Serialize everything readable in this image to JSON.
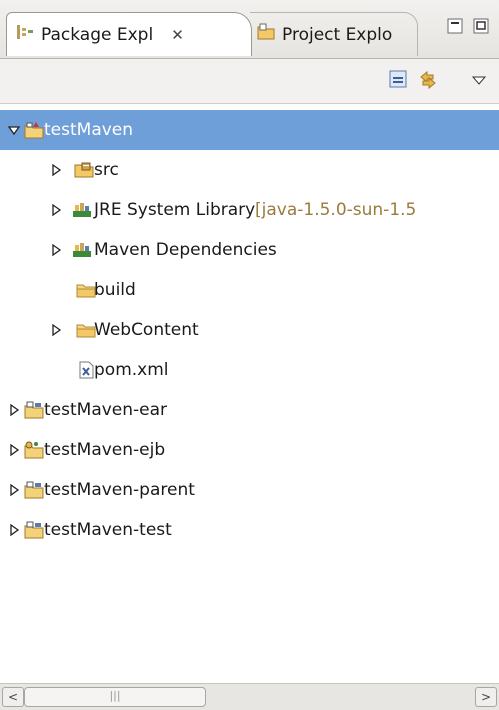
{
  "tabs": [
    {
      "label": "Package Expl",
      "close": "✕",
      "icon": "package-explorer-icon"
    },
    {
      "label": "Project Explo",
      "icon": "project-explorer-icon"
    }
  ],
  "tab_controls": {
    "minimize": "−",
    "maximize": "□"
  },
  "toolbar": {
    "collapse_icon": "collapse-all-icon",
    "link_icon": "link-with-editor-icon",
    "menu_icon": "view-menu-icon"
  },
  "tree": [
    {
      "label": "testMaven",
      "extra": "",
      "icon": "maven-project-icon",
      "twisty": "expanded",
      "selected": true
    },
    {
      "label": "src",
      "extra": "",
      "icon": "source-folder-icon",
      "twisty": "collapsed"
    },
    {
      "label": "JRE System Library ",
      "extra": "[java-1.5.0-sun-1.5",
      "icon": "library-icon",
      "twisty": "collapsed"
    },
    {
      "label": "Maven Dependencies",
      "extra": "",
      "icon": "library-icon",
      "twisty": "collapsed"
    },
    {
      "label": "build",
      "extra": "",
      "icon": "folder-icon",
      "twisty": "none"
    },
    {
      "label": "WebContent",
      "extra": "",
      "icon": "folder-icon",
      "twisty": "collapsed"
    },
    {
      "label": "pom.xml",
      "extra": "",
      "icon": "xml-file-icon",
      "twisty": "none"
    },
    {
      "label": "testMaven-ear",
      "extra": "",
      "icon": "project-icon",
      "twisty": "collapsed"
    },
    {
      "label": "testMaven-ejb",
      "extra": "",
      "icon": "ejb-project-icon",
      "twisty": "collapsed"
    },
    {
      "label": "testMaven-parent",
      "extra": "",
      "icon": "project-icon",
      "twisty": "collapsed"
    },
    {
      "label": "testMaven-test",
      "extra": "",
      "icon": "project-icon",
      "twisty": "collapsed"
    }
  ],
  "scrollbar": {
    "left": "<",
    "right": ">",
    "grip": "|||"
  },
  "colors": {
    "selection": "#6f9fd8",
    "folder": "#e8b84a",
    "library": "#3a8a3a"
  }
}
